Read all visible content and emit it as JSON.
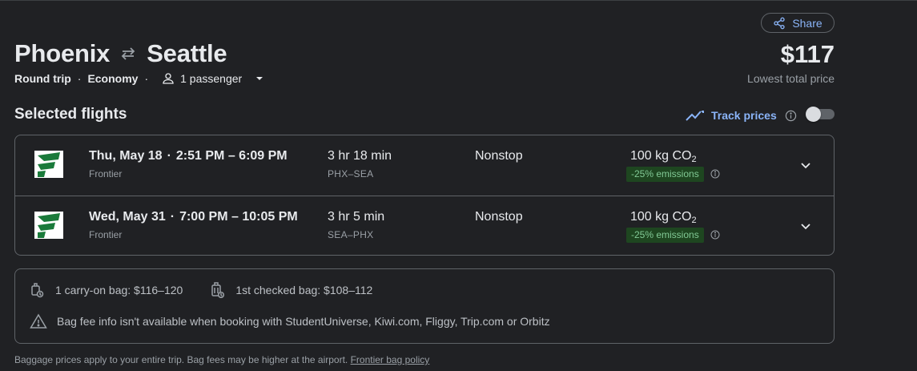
{
  "header": {
    "share_label": "Share",
    "origin": "Phoenix",
    "destination": "Seattle",
    "trip_type": "Round trip",
    "cabin": "Economy",
    "passengers": "1 passenger",
    "price": "$117",
    "price_label": "Lowest total price"
  },
  "selected": {
    "title": "Selected flights",
    "track_label": "Track prices",
    "track_enabled": false
  },
  "flights": [
    {
      "date": "Thu, May 18",
      "time": "2:51 PM – 6:09 PM",
      "airline": "Frontier",
      "duration": "3 hr 18 min",
      "route": "PHX–SEA",
      "stops": "Nonstop",
      "co2": "100 kg CO",
      "co2_sub": "2",
      "emissions": "-25% emissions"
    },
    {
      "date": "Wed, May 31",
      "time": "7:00 PM – 10:05 PM",
      "airline": "Frontier",
      "duration": "3 hr 5 min",
      "route": "SEA–PHX",
      "stops": "Nonstop",
      "co2": "100 kg CO",
      "co2_sub": "2",
      "emissions": "-25% emissions"
    }
  ],
  "bags": {
    "carry_on": "1 carry-on bag: $116–120",
    "checked": "1st checked bag: $108–112",
    "warning": "Bag fee info isn't available when booking with StudentUniverse, Kiwi.com, Fliggy, Trip.com or Orbitz"
  },
  "footnote": {
    "text": "Baggage prices apply to your entire trip. Bag fees may be higher at the airport. ",
    "link": "Frontier bag policy"
  },
  "colors": {
    "background": "#202124",
    "accent": "#8ab4f8",
    "emissions_bg": "#1e4620",
    "emissions_text": "#81c995",
    "frontier_green": "#1a7a3a"
  }
}
